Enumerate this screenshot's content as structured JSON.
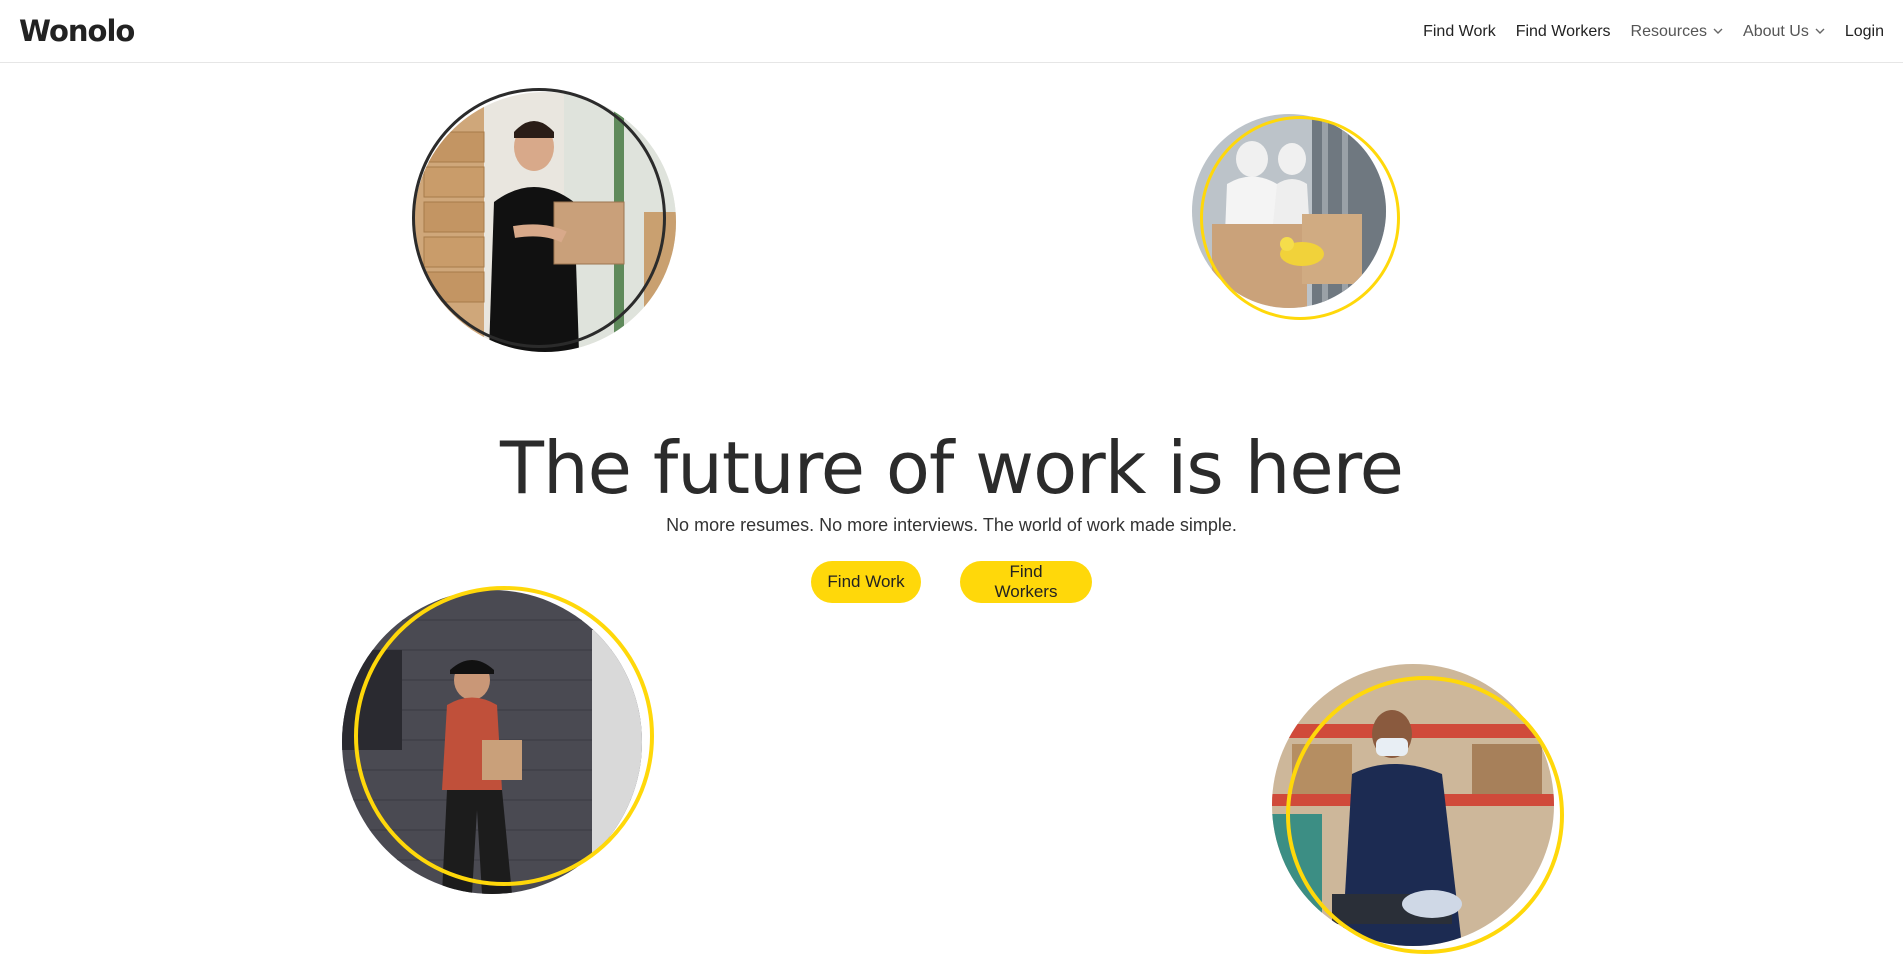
{
  "brand": {
    "name": "Wonolo",
    "accent": "#FFD80A",
    "text_color": "#2B2B2B"
  },
  "nav": {
    "items": [
      {
        "label": "Find Work",
        "has_dropdown": false
      },
      {
        "label": "Find Workers",
        "has_dropdown": false
      },
      {
        "label": "Resources",
        "has_dropdown": true
      },
      {
        "label": "About Us",
        "has_dropdown": true
      },
      {
        "label": "Login",
        "has_dropdown": false
      }
    ]
  },
  "hero": {
    "title": "The future of work is here",
    "subtitle": "No more resumes. No more interviews. The world of work made simple.",
    "buttons": [
      {
        "label": "Find Work"
      },
      {
        "label": "Find Workers"
      }
    ]
  },
  "photos": [
    {
      "subject": "warehouse-worker-carrying-box",
      "ring": "dark"
    },
    {
      "subject": "food-packing-workers",
      "ring": "yellow"
    },
    {
      "subject": "delivery-worker-with-bag",
      "ring": "yellow"
    },
    {
      "subject": "masked-warehouse-worker",
      "ring": "yellow"
    }
  ]
}
